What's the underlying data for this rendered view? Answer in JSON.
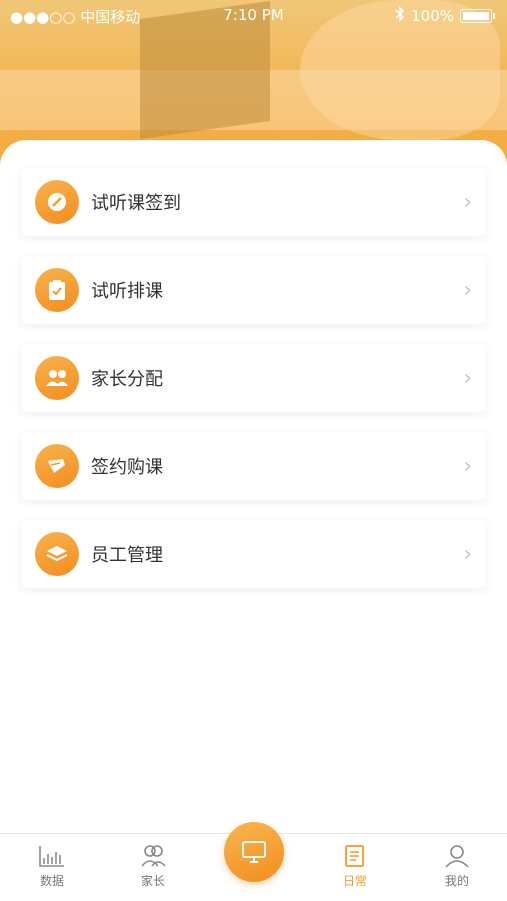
{
  "status": {
    "carrier": "●●●○○ 中国移动",
    "time": "7:10 PM",
    "battery": "100%"
  },
  "menu": [
    {
      "label": "试听课签到",
      "icon": "pencil-icon"
    },
    {
      "label": "试听排课",
      "icon": "clipboard-check-icon"
    },
    {
      "label": "家长分配",
      "icon": "people-icon"
    },
    {
      "label": "签约购课",
      "icon": "signature-icon"
    },
    {
      "label": "员工管理",
      "icon": "layers-icon"
    }
  ],
  "tabs": [
    {
      "label": "数据"
    },
    {
      "label": "家长"
    },
    {
      "label": "日常",
      "active": true
    },
    {
      "label": "我的"
    }
  ],
  "colors": {
    "accent": "#f39a27",
    "text": "#333333",
    "muted": "#777777"
  }
}
